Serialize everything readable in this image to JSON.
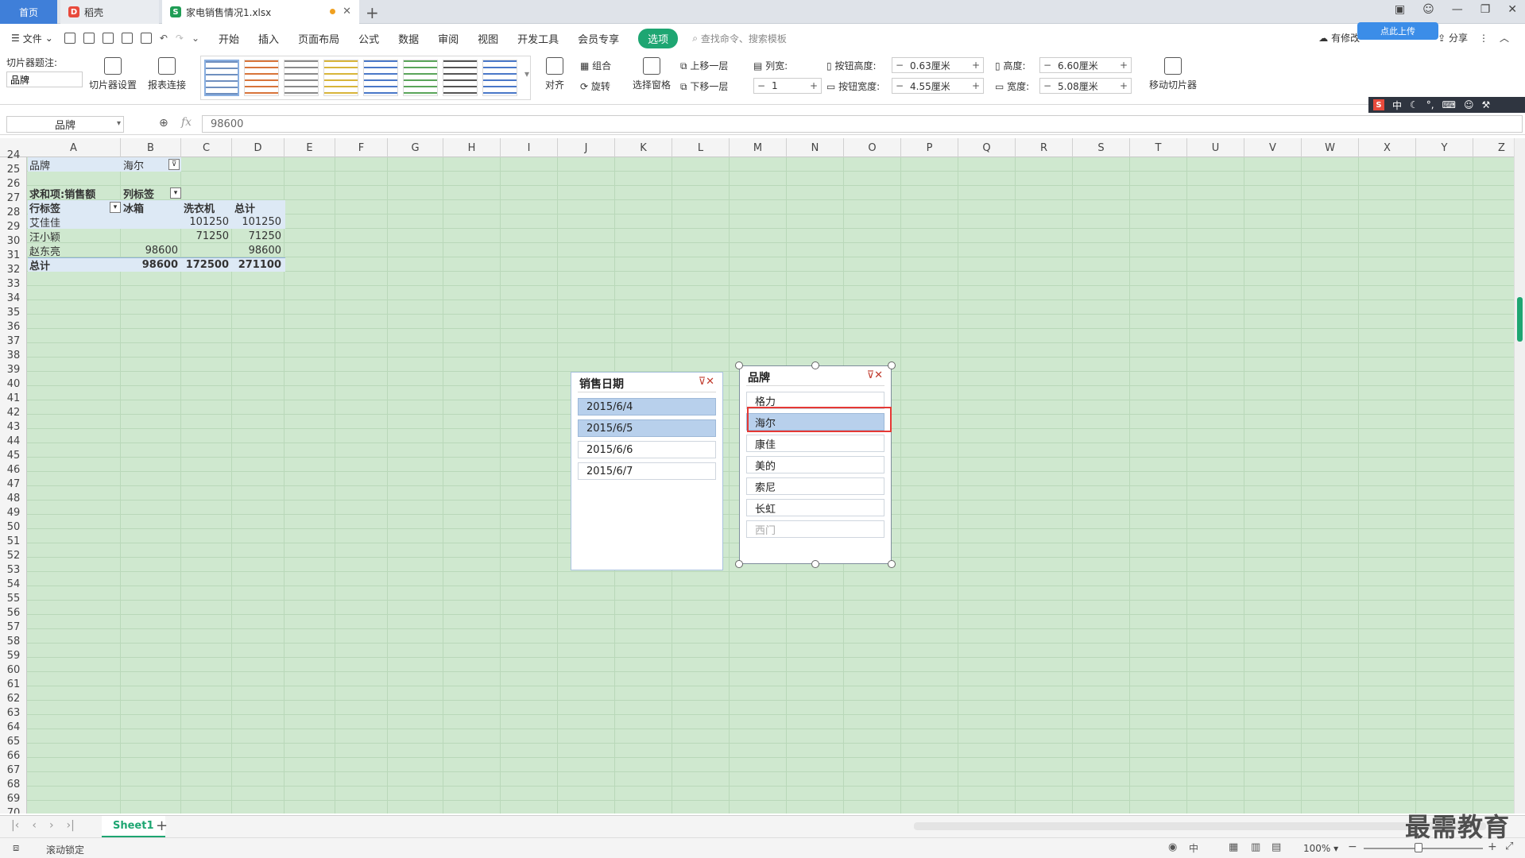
{
  "tabs": {
    "home": "首页",
    "daoke": "稻壳",
    "file": "家电销售情况1.xlsx"
  },
  "menu": {
    "file": "文件",
    "items": [
      "开始",
      "插入",
      "页面布局",
      "公式",
      "数据",
      "审阅",
      "视图",
      "开发工具",
      "会员专享"
    ],
    "active": "选项",
    "search": "查找命令、搜索模板",
    "share": "分享",
    "cloud": "有修改",
    "cloud_badge": "点此上传"
  },
  "ribbon": {
    "caption_label": "切片器题注:",
    "caption_value": "品牌",
    "slicer_settings": "切片器设置",
    "report_connections": "报表连接",
    "align": "对齐",
    "group": "组合",
    "rotate": "旋转",
    "selection_pane": "选择窗格",
    "bring_forward": "上移一层",
    "send_backward": "下移一层",
    "columns_label": "列宽:",
    "columns_value": "1",
    "button_height_label": "按钮高度:",
    "button_height_value": "0.63厘米",
    "button_width_label": "按钮宽度:",
    "button_width_value": "4.55厘米",
    "height_label": "高度:",
    "height_value": "6.60厘米",
    "width_label": "宽度:",
    "width_value": "5.08厘米",
    "move_slicer": "移动切片器",
    "style_colors": [
      "#6f8fbf",
      "#d8743a",
      "#8a8a8a",
      "#d8b53a",
      "#4a78c8",
      "#5aa55a",
      "#555555",
      "#4a78c8"
    ]
  },
  "ime": {
    "logo": "S",
    "mode": "中"
  },
  "formula": {
    "namebox": "品牌",
    "value": "98600"
  },
  "columns": [
    "A",
    "B",
    "C",
    "D",
    "E",
    "F",
    "G",
    "H",
    "I",
    "J",
    "K",
    "L",
    "M",
    "N",
    "O",
    "P",
    "Q",
    "R",
    "S",
    "T",
    "U",
    "V",
    "W",
    "X",
    "Y",
    "Z"
  ],
  "rows": [
    "24",
    "25",
    "26",
    "27",
    "28",
    "29",
    "30",
    "31",
    "32",
    "33",
    "34",
    "35",
    "36",
    "37",
    "38",
    "39",
    "40",
    "41",
    "42",
    "43",
    "44",
    "45",
    "46",
    "47",
    "48",
    "49",
    "50",
    "51",
    "52",
    "53",
    "54",
    "55",
    "56",
    "57",
    "58",
    "59",
    "60",
    "61",
    "62",
    "63",
    "64",
    "65",
    "66",
    "67",
    "68",
    "69",
    "70"
  ],
  "pivot": {
    "filter_field": "品牌",
    "filter_value": "海尔",
    "sum_label": "求和项:销售额",
    "col_label": "列标签",
    "row_label": "行标签",
    "headers": [
      "冰箱",
      "洗衣机",
      "总计"
    ],
    "rows": [
      {
        "name": "艾佳佳",
        "b": "",
        "c": "101250",
        "d": "101250"
      },
      {
        "name": "汪小颖",
        "b": "",
        "c": "71250",
        "d": "71250"
      },
      {
        "name": "赵东亮",
        "b": "98600",
        "c": "",
        "d": "98600"
      }
    ],
    "total": {
      "name": "总计",
      "b": "98600",
      "c": "172500",
      "d": "271100"
    }
  },
  "slicer_date": {
    "title": "销售日期",
    "items": [
      {
        "label": "2015/6/4",
        "state": "selected"
      },
      {
        "label": "2015/6/5",
        "state": "selected"
      },
      {
        "label": "2015/6/6",
        "state": "normal"
      },
      {
        "label": "2015/6/7",
        "state": "normal"
      }
    ]
  },
  "slicer_brand": {
    "title": "品牌",
    "items": [
      {
        "label": "格力",
        "state": "normal"
      },
      {
        "label": "海尔",
        "state": "selected"
      },
      {
        "label": "康佳",
        "state": "normal"
      },
      {
        "label": "美的",
        "state": "normal"
      },
      {
        "label": "索尼",
        "state": "normal"
      },
      {
        "label": "长虹",
        "state": "normal"
      },
      {
        "label": "西门",
        "state": "dim"
      }
    ]
  },
  "sheet": {
    "tab": "Sheet1"
  },
  "status": {
    "left": "滚动锁定",
    "zoom": "100%"
  },
  "watermark": "最需教育"
}
